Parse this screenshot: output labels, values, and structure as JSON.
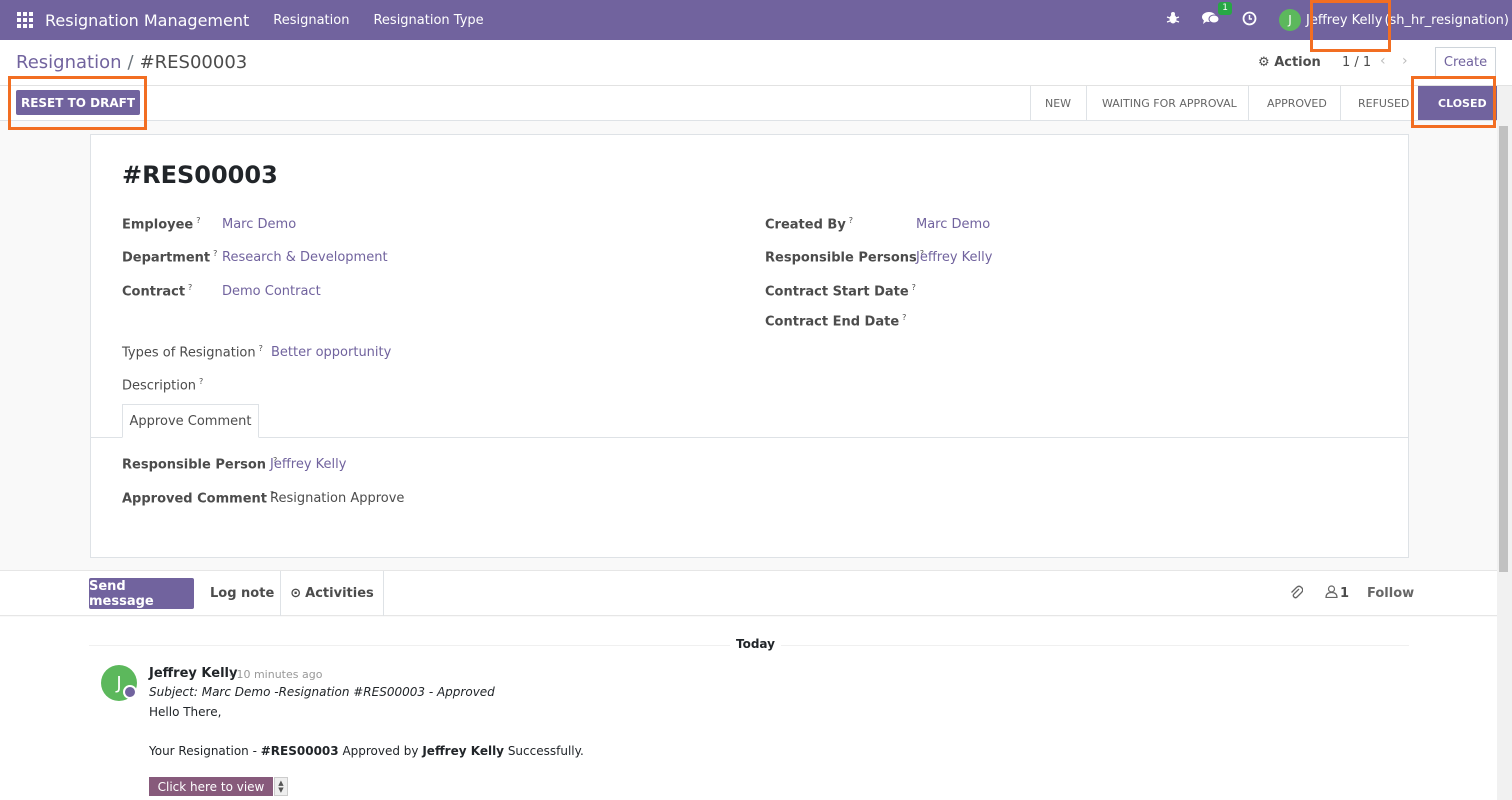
{
  "navbar": {
    "brand": "Resignation Management",
    "menus": [
      "Resignation",
      "Resignation Type"
    ],
    "messages_badge": "1",
    "user_initial": "J",
    "user_name": "Jeffrey Kelly",
    "user_db": "(sh_hr_resignation)"
  },
  "control_panel": {
    "breadcrumb_parent": "Resignation",
    "breadcrumb_separator": "/",
    "breadcrumb_current": "#RES00003",
    "action_label": "Action",
    "pager_value": "1 / 1",
    "create_label": "Create"
  },
  "statusbar": {
    "reset_label": "RESET TO DRAFT",
    "stages": [
      "NEW",
      "WAITING FOR APPROVAL",
      "APPROVED",
      "REFUSED",
      "CLOSED"
    ],
    "active_stage": "CLOSED"
  },
  "form": {
    "title": "#RES00003",
    "left_fields": [
      {
        "label": "Employee",
        "value": "Marc Demo"
      },
      {
        "label": "Department",
        "value": "Research & Development"
      },
      {
        "label": "Contract",
        "value": "Demo Contract"
      }
    ],
    "right_fields": [
      {
        "label": "Created By",
        "value": "Marc Demo"
      },
      {
        "label": "Responsible Persons",
        "value": "Jeffrey Kelly"
      },
      {
        "label": "Contract Start Date",
        "value": ""
      },
      {
        "label": "Contract End Date",
        "value": ""
      }
    ],
    "types_label": "Types of Resignation",
    "types_value": "Better opportunity",
    "description_label": "Description",
    "tab_label": "Approve Comment",
    "tab_fields": [
      {
        "label": "Responsible Person",
        "value": "Jeffrey Kelly"
      },
      {
        "label": "Approved Comment",
        "value": "Resignation Approve"
      }
    ],
    "help_mark": "?"
  },
  "chatter": {
    "send_message": "Send message",
    "log_note": "Log note",
    "activities": "Activities",
    "follower_count": "1",
    "follow": "Follow",
    "date_separator": "Today",
    "message": {
      "author_initial": "J",
      "author": "Jeffrey Kelly",
      "time": "- 10 minutes ago",
      "subject": "Subject: Marc Demo -Resignation #RES00003 - Approved",
      "greeting": "Hello There,",
      "body_prefix": "Your Resignation - ",
      "body_ref": "#RES00003",
      "body_mid": " Approved by ",
      "body_user": "Jeffrey Kelly",
      "body_suffix": " Successfully.",
      "view_button": "Click here to view"
    }
  },
  "colors": {
    "brand": "#71639e",
    "highlight": "#f26e22",
    "avatar": "#5cb85c"
  }
}
